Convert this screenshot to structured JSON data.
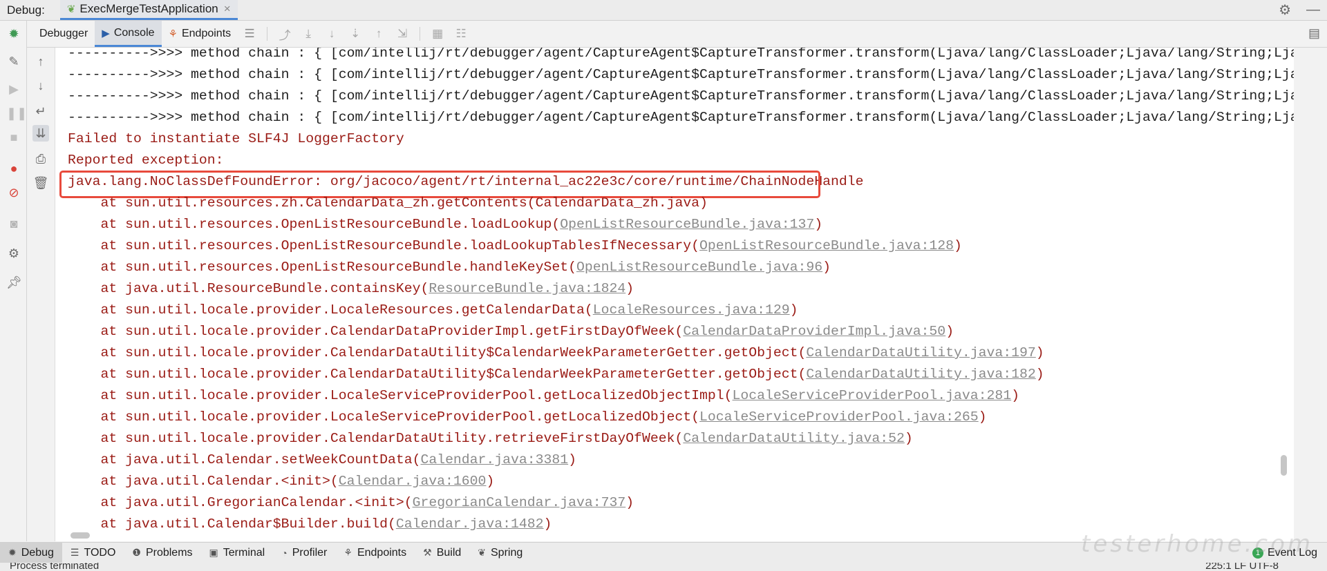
{
  "titlebar": {
    "label": "Debug:",
    "run_tab": "ExecMergeTestApplication",
    "close": "×"
  },
  "subtoolbar": {
    "tabs": [
      {
        "label": "Debugger"
      },
      {
        "label": "Console"
      },
      {
        "label": "Endpoints"
      }
    ]
  },
  "console": {
    "method_chain_lines": [
      "---------->>>> method chain : { [com/intellij/rt/debugger/agent/CaptureAgent$CaptureTransformer.transform(Ljava/lang/ClassLoader;Ljava/lang/String;Ljava/lang/Class;",
      "---------->>>> method chain : { [com/intellij/rt/debugger/agent/CaptureAgent$CaptureTransformer.transform(Ljava/lang/ClassLoader;Ljava/lang/String;Ljava/lang/Class;",
      "---------->>>> method chain : { [com/intellij/rt/debugger/agent/CaptureAgent$CaptureTransformer.transform(Ljava/lang/ClassLoader;Ljava/lang/String;Ljava/lang/Class;",
      "---------->>>> method chain : { [com/intellij/rt/debugger/agent/CaptureAgent$CaptureTransformer.transform(Ljava/lang/ClassLoader;Ljava/lang/String;Ljava/lang/Class;"
    ],
    "failed": "Failed to instantiate SLF4J LoggerFactory",
    "reported": "Reported exception:",
    "error": "java.lang.NoClassDefFoundError: org/jacoco/agent/rt/internal_ac22e3c/core/runtime/ChainNodeHandle",
    "stack": [
      {
        "prefix": "    at sun.util.resources.zh.CalendarData_zh.getContents(",
        "link": "CalendarData_zh.java",
        "suffix": ")"
      },
      {
        "prefix": "    at sun.util.resources.OpenListResourceBundle.loadLookup(",
        "link": "OpenListResourceBundle.java:137",
        "suffix": ")"
      },
      {
        "prefix": "    at sun.util.resources.OpenListResourceBundle.loadLookupTablesIfNecessary(",
        "link": "OpenListResourceBundle.java:128",
        "suffix": ")"
      },
      {
        "prefix": "    at sun.util.resources.OpenListResourceBundle.handleKeySet(",
        "link": "OpenListResourceBundle.java:96",
        "suffix": ")"
      },
      {
        "prefix": "    at java.util.ResourceBundle.containsKey(",
        "link": "ResourceBundle.java:1824",
        "suffix": ")"
      },
      {
        "prefix": "    at sun.util.locale.provider.LocaleResources.getCalendarData(",
        "link": "LocaleResources.java:129",
        "suffix": ")"
      },
      {
        "prefix": "    at sun.util.locale.provider.CalendarDataProviderImpl.getFirstDayOfWeek(",
        "link": "CalendarDataProviderImpl.java:50",
        "suffix": ")"
      },
      {
        "prefix": "    at sun.util.locale.provider.CalendarDataUtility$CalendarWeekParameterGetter.getObject(",
        "link": "CalendarDataUtility.java:197",
        "suffix": ")"
      },
      {
        "prefix": "    at sun.util.locale.provider.CalendarDataUtility$CalendarWeekParameterGetter.getObject(",
        "link": "CalendarDataUtility.java:182",
        "suffix": ")"
      },
      {
        "prefix": "    at sun.util.locale.provider.LocaleServiceProviderPool.getLocalizedObjectImpl(",
        "link": "LocaleServiceProviderPool.java:281",
        "suffix": ")"
      },
      {
        "prefix": "    at sun.util.locale.provider.LocaleServiceProviderPool.getLocalizedObject(",
        "link": "LocaleServiceProviderPool.java:265",
        "suffix": ")"
      },
      {
        "prefix": "    at sun.util.locale.provider.CalendarDataUtility.retrieveFirstDayOfWeek(",
        "link": "CalendarDataUtility.java:52",
        "suffix": ")"
      },
      {
        "prefix": "    at java.util.Calendar.setWeekCountData(",
        "link": "Calendar.java:3381",
        "suffix": ")"
      },
      {
        "prefix": "    at java.util.Calendar.<init>(",
        "link": "Calendar.java:1600",
        "suffix": ")"
      },
      {
        "prefix": "    at java.util.GregorianCalendar.<init>(",
        "link": "GregorianCalendar.java:737",
        "suffix": ")"
      },
      {
        "prefix": "    at java.util.Calendar$Builder.build(",
        "link": "Calendar.java:1482",
        "suffix": ")"
      }
    ]
  },
  "bottombar": {
    "tabs": [
      {
        "label": "Debug"
      },
      {
        "label": "TODO"
      },
      {
        "label": "Problems"
      },
      {
        "label": "Terminal"
      },
      {
        "label": "Profiler"
      },
      {
        "label": "Endpoints"
      },
      {
        "label": "Build"
      },
      {
        "label": "Spring"
      }
    ],
    "event_log": "Event Log"
  },
  "statusbar": {
    "left": "Process terminated",
    "right": "225:1   LF   UTF-8"
  },
  "watermark": "testerhome.com",
  "colors": {
    "error_text": "#9a1b15",
    "highlight_box": "#e84a3c",
    "active_tab_underline": "#4a87d6"
  }
}
